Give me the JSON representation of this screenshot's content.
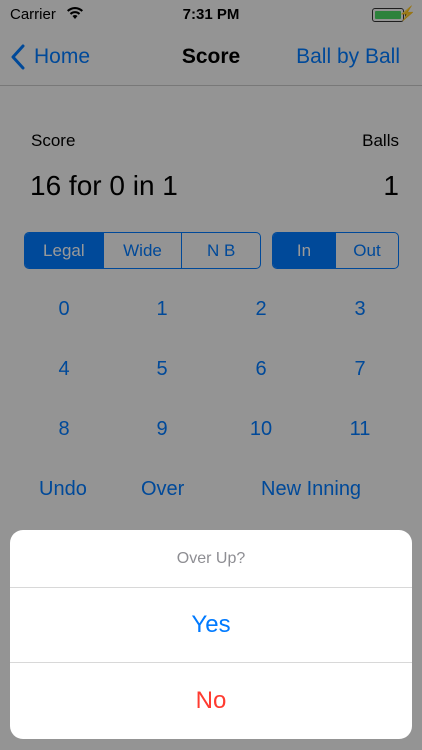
{
  "status_bar": {
    "carrier": "Carrier",
    "time": "7:31 PM"
  },
  "nav": {
    "back_label": "Home",
    "title": "Score",
    "right_label": "Ball by Ball"
  },
  "score": {
    "score_label": "Score",
    "balls_label": "Balls",
    "score_value": "16 for 0 in 1",
    "balls_value": "1"
  },
  "delivery_type": {
    "options": [
      "Legal",
      "Wide",
      "N B"
    ],
    "selected": "Legal"
  },
  "batting": {
    "options": [
      "In",
      "Out"
    ],
    "selected": "In"
  },
  "runs": [
    "0",
    "1",
    "2",
    "3",
    "4",
    "5",
    "6",
    "7",
    "8",
    "9",
    "10",
    "11"
  ],
  "actions": {
    "undo": "Undo",
    "over": "Over",
    "new_inning": "New Inning"
  },
  "action_sheet": {
    "title": "Over Up?",
    "yes": "Yes",
    "no": "No"
  },
  "colors": {
    "accent": "#007aff",
    "destructive": "#ff3b30",
    "battery": "#4cd964"
  }
}
